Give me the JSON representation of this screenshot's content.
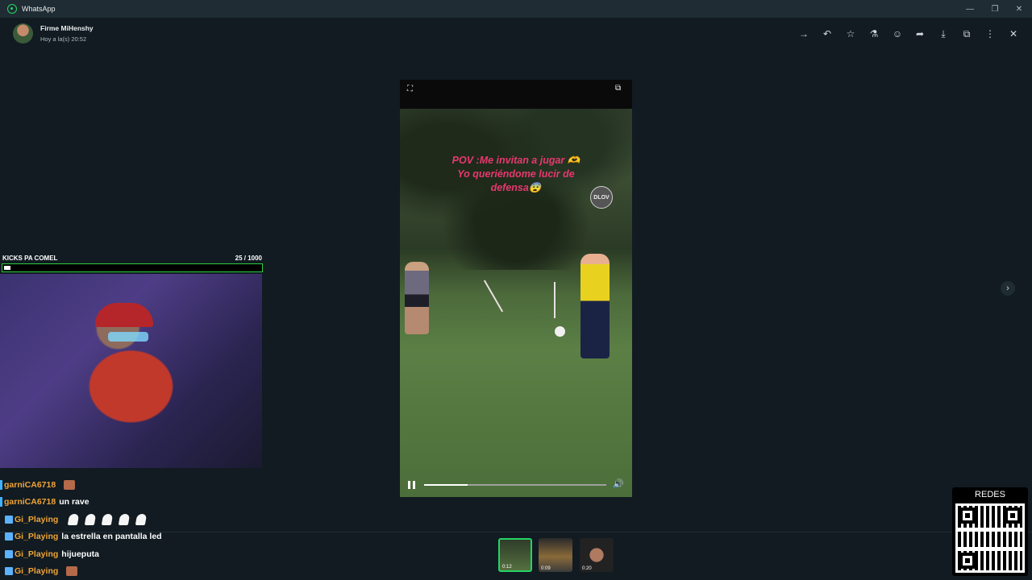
{
  "window": {
    "title": "WhatsApp",
    "controls": [
      "minimize",
      "restore",
      "close"
    ]
  },
  "header": {
    "sender": "Firme MiHenshy",
    "timestamp": "Hoy a la(s) 20:52",
    "actions": [
      "forward-arrow-icon",
      "reply-icon",
      "star-icon",
      "pin-icon",
      "emoji-icon",
      "share-icon",
      "download-icon",
      "open-external-icon",
      "more-icon",
      "close-icon"
    ]
  },
  "video": {
    "overlay_line1": "POV :Me invitan a jugar 🫶",
    "overlay_line2": "Yo queriéndome lucir de",
    "overlay_line3": "defensa😨",
    "logo_text": "DLOV",
    "progress": 0.24
  },
  "thumbnails": [
    {
      "duration": "0:12",
      "active": true
    },
    {
      "duration": "0:09",
      "active": false
    },
    {
      "duration": "0:20",
      "active": false
    }
  ],
  "stream": {
    "goal_title": "KICKS PA COMEL",
    "goal_count": "25  / 1000",
    "goal_progress": 0.025
  },
  "chat": [
    {
      "user": "garniCA6718",
      "message": "",
      "badge": "bar",
      "emote": true
    },
    {
      "user": "garniCA6718",
      "message": "un rave",
      "badge": "bar",
      "emote": false
    },
    {
      "user": "Gi_Playing",
      "message": "",
      "badge": "square",
      "ghosts": 5
    },
    {
      "user": "Gi_Playing",
      "message": "la estrella en pantalla led",
      "badge": "square"
    },
    {
      "user": "Gi_Playing",
      "message": "hijueputa",
      "badge": "square"
    },
    {
      "user": "Gi_Playing",
      "message": "",
      "badge": "square",
      "emote": true
    }
  ],
  "qr": {
    "title": "REDES"
  }
}
